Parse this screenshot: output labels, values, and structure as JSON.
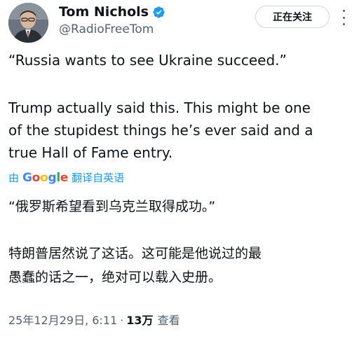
{
  "author": {
    "display_name": "Tom Nichols",
    "handle": "@RadioFreeTom",
    "avatar_icon": "avatar-photo",
    "verified_icon": "verified-badge-icon",
    "verified_color": "#1d9bf0"
  },
  "actions": {
    "follow_label": "正在关注",
    "more_icon": "more-options-icon"
  },
  "tweet": {
    "quote": "“Russia wants to see Ukraine succeed.”",
    "body": "Trump actually said this. This might be one\nof the stupidest things he’s ever said and a\ntrue Hall of Fame entry."
  },
  "translation": {
    "prefix": "由",
    "provider_g1": "G",
    "provider_o1": "o",
    "provider_o2": "o",
    "provider_g2": "g",
    "provider_l": "l",
    "provider_e": "e",
    "suffix": "翻译自英语",
    "quote": "“俄罗斯希望看到乌克兰取得成功。”",
    "body": "特朗普居然说了这话。这可能是他说过的最\n愚蠢的话之一，绝对可以载入史册。"
  },
  "meta": {
    "timestamp": "25年12月29日, 6:11",
    "separator": "·",
    "views_count": "13万",
    "views_label": "查看"
  },
  "colors": {
    "text_primary": "#0f1419",
    "text_secondary": "#536471",
    "accent": "#1d9bf0",
    "border": "#cfd9de"
  }
}
